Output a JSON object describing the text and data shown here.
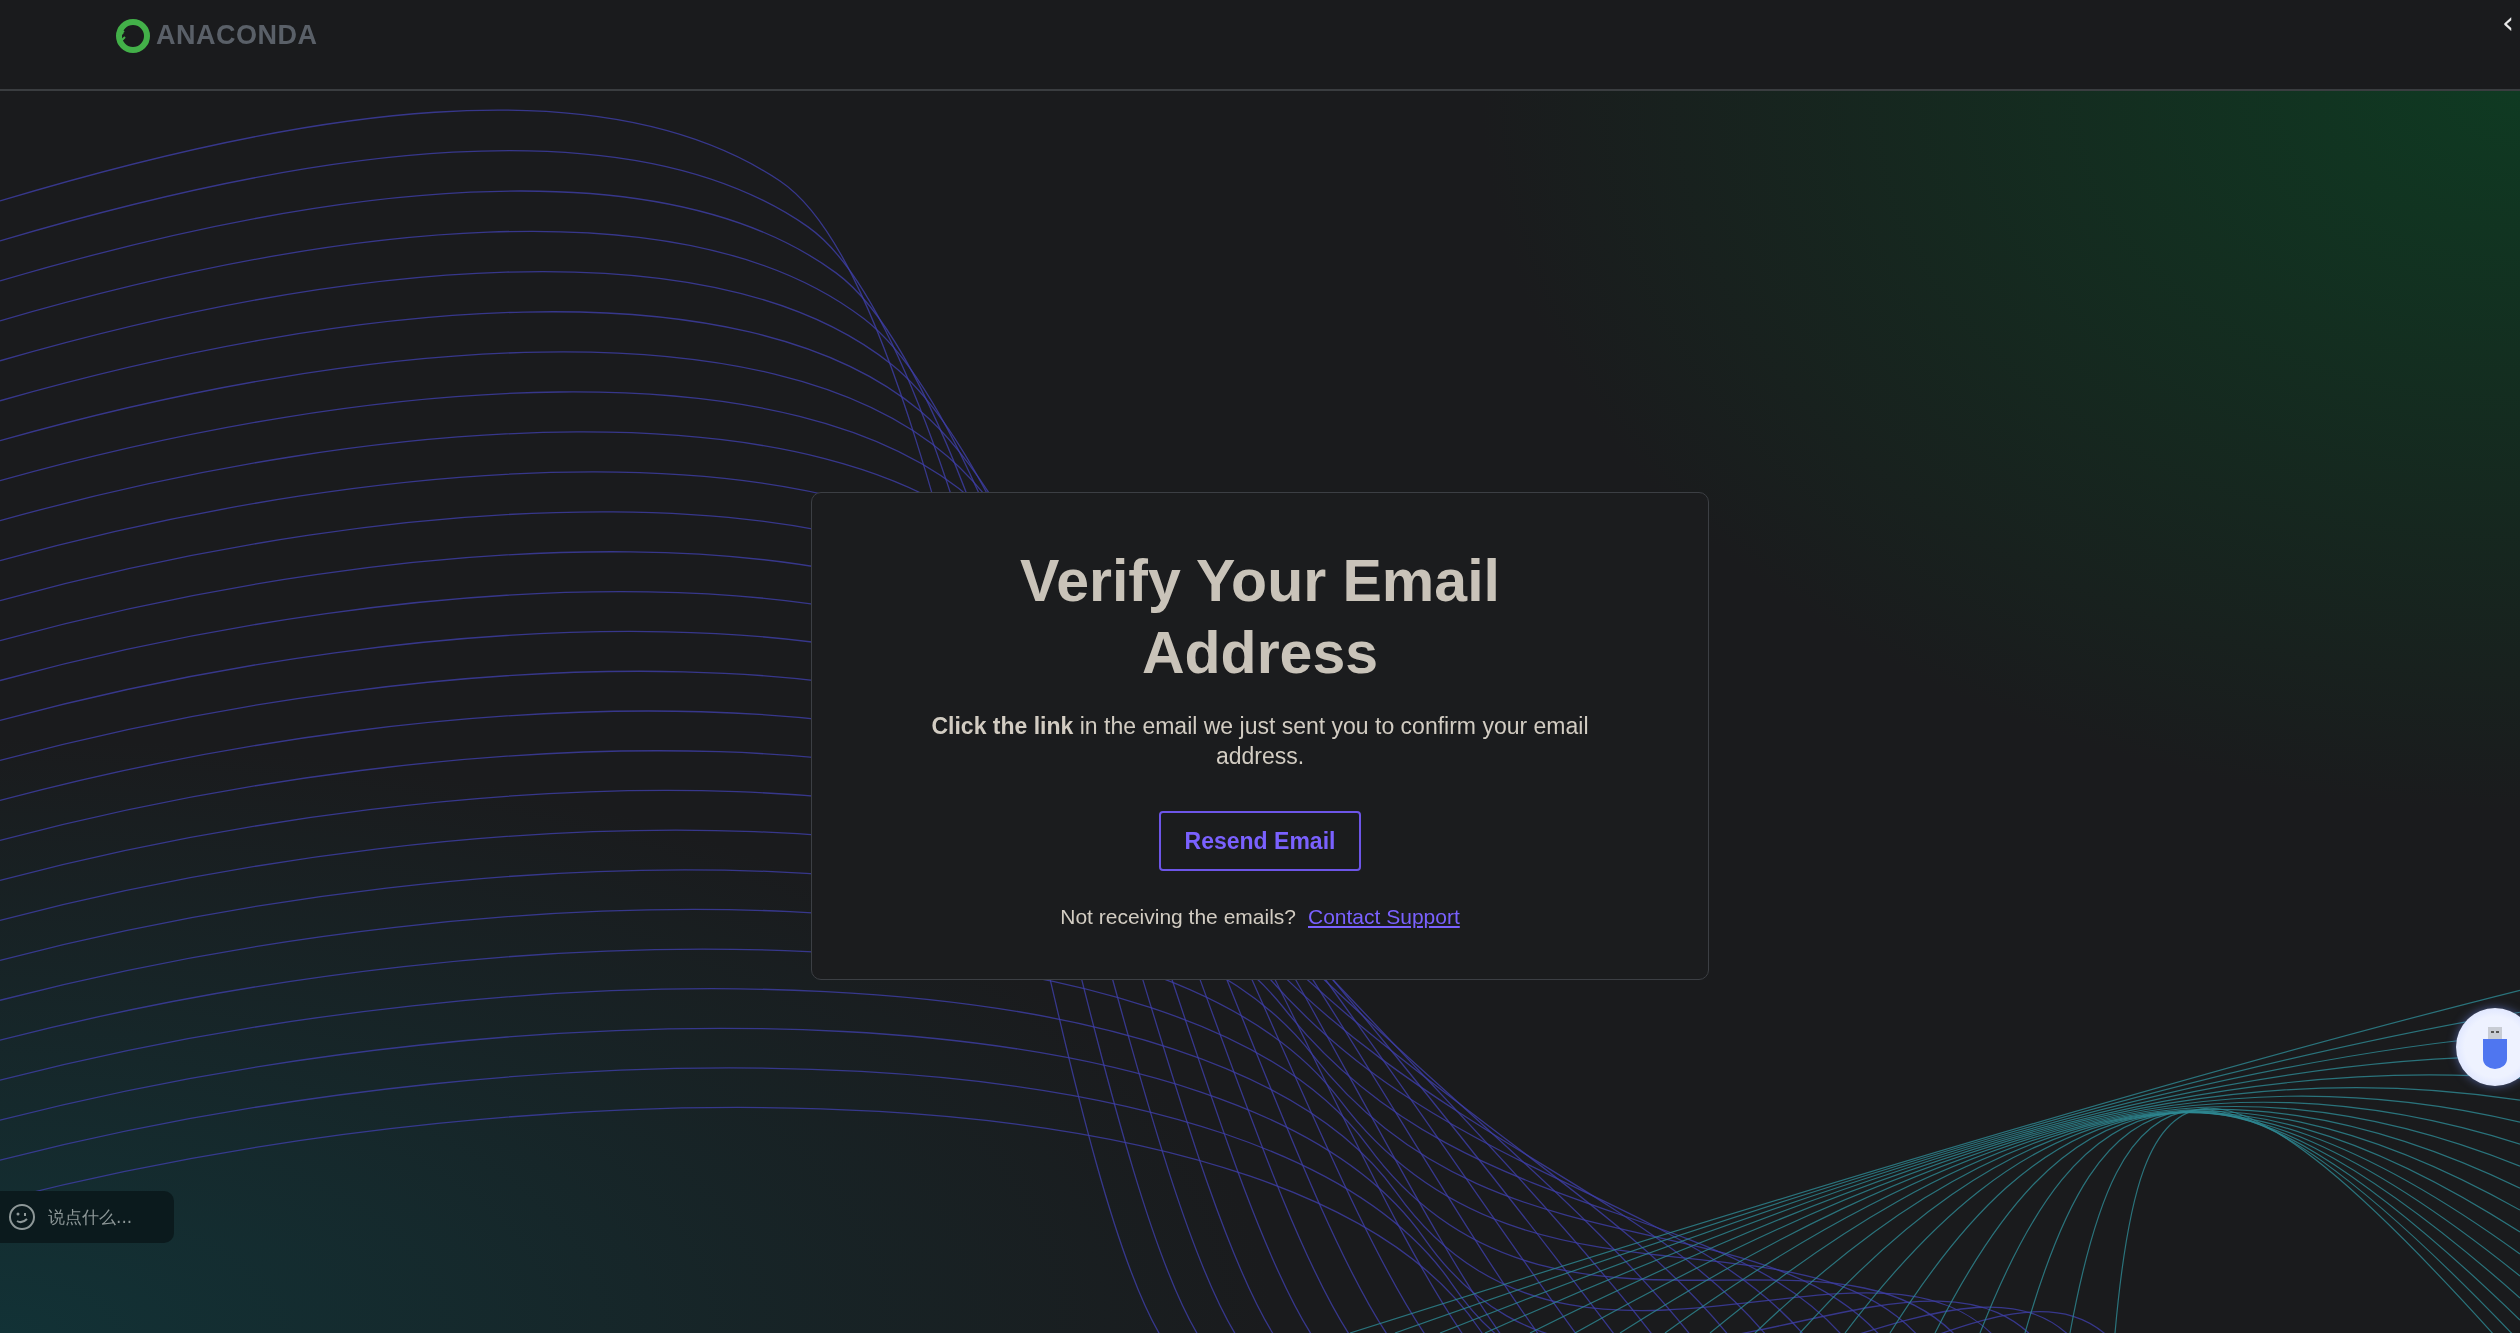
{
  "header": {
    "logo_text": "ANACONDA",
    "collapse_glyph": "‹"
  },
  "card": {
    "title": "Verify Your Email Address",
    "message": "**Click the link** in the email we just sent you to confirm your email address.",
    "button": "Resend Email",
    "footer_text": "Not receiving the emails?",
    "footer_link": "Contact Support"
  },
  "chat_box": {
    "placeholder": "说点什么..."
  }
}
